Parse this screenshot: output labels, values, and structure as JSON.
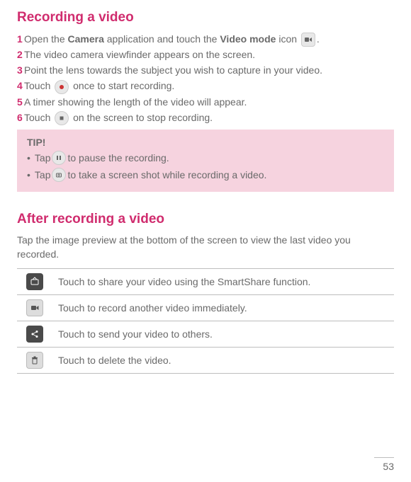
{
  "section1": {
    "title": "Recording a video",
    "steps": [
      {
        "num": "1",
        "pre": "Open the ",
        "b1": "Camera",
        "mid": " application and touch the ",
        "b2": "Video mode",
        "post": " icon ",
        "tail": "."
      },
      {
        "num": "2",
        "text": "The video camera viewfinder appears on the screen."
      },
      {
        "num": "3",
        "text": "Point the lens towards the subject you wish to capture in your video."
      },
      {
        "num": "4",
        "pre": "Touch ",
        "post": " once to start recording."
      },
      {
        "num": "5",
        "text": "A timer showing the length of the video will appear."
      },
      {
        "num": "6",
        "pre": "Touch ",
        "post": " on the screen to stop recording."
      }
    ]
  },
  "tip": {
    "title": "TIP!",
    "line1_pre": "Tap ",
    "line1_post": " to pause the recording.",
    "line2_pre": "Tap ",
    "line2_post": " to take a screen shot while recording a video."
  },
  "section2": {
    "title": "After recording a video",
    "intro": "Tap the image preview at the bottom of the screen to view the last video you recorded.",
    "rows": [
      "Touch to share your video using the SmartShare function.",
      "Touch to record another video immediately.",
      "Touch to send your video to others.",
      "Touch to delete the video."
    ]
  },
  "page_number": "53"
}
